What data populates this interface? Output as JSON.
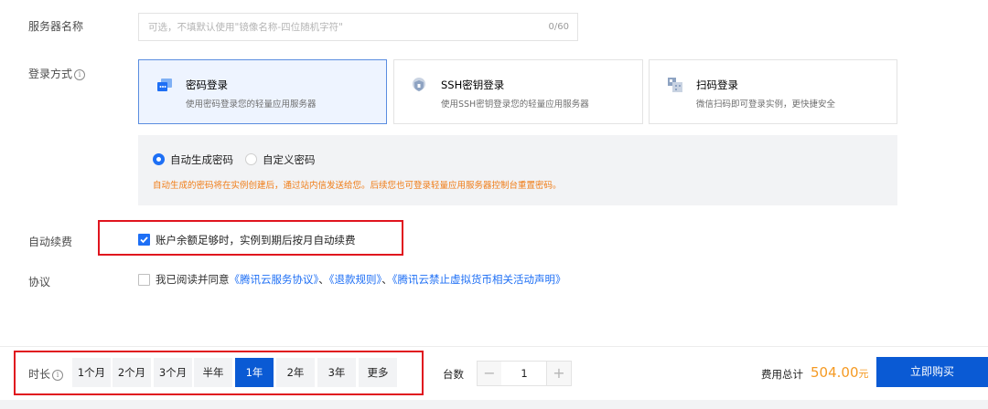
{
  "server_name": {
    "label": "服务器名称",
    "placeholder": "可选，不填默认使用\"镜像名称-四位随机字符\"",
    "count": "0/60"
  },
  "login": {
    "label": "登录方式",
    "info_icon": "info-circle-icon",
    "options": [
      {
        "title": "密码登录",
        "desc": "使用密码登录您的轻量应用服务器",
        "icon": "password-icon",
        "selected": true
      },
      {
        "title": "SSH密钥登录",
        "desc": "使用SSH密钥登录您的轻量应用服务器",
        "icon": "ssh-key-icon",
        "selected": false
      },
      {
        "title": "扫码登录",
        "desc": "微信扫码即可登录实例，更快捷安全",
        "icon": "qr-scan-icon",
        "selected": false
      }
    ],
    "password_modes": [
      {
        "label": "自动生成密码",
        "selected": true
      },
      {
        "label": "自定义密码",
        "selected": false
      }
    ],
    "password_note": "自动生成的密码将在实例创建后，通过站内信发送给您。后续您也可登录轻量应用服务器控制台重置密码。"
  },
  "auto_renew": {
    "label": "自动续费",
    "checkbox_label": "账户余额足够时，实例到期后按月自动续费",
    "checked": true
  },
  "agreement": {
    "label": "协议",
    "prefix": "我已阅读并同意",
    "link1": "《腾讯云服务协议》",
    "sep1": "、",
    "link2": "《退款规则》",
    "sep2": "、",
    "link3": "《腾讯云禁止虚拟货币相关活动声明》",
    "checked": false
  },
  "duration": {
    "label": "时长",
    "options": [
      "1个月",
      "2个月",
      "3个月",
      "半年",
      "1年",
      "2年",
      "3年",
      "更多"
    ],
    "selected": "1年"
  },
  "quantity": {
    "label": "台数",
    "minus": "−",
    "value": "1",
    "plus": "+"
  },
  "total": {
    "label": "费用总计",
    "amount": "504.00",
    "unit": "元"
  },
  "buy_button": "立即购买",
  "colors": {
    "primary": "#0a5ad4",
    "accent_blue": "#1e6ff5",
    "price_orange": "#f59a23",
    "note_orange": "#f07c16",
    "highlight_red": "#e0141e"
  }
}
